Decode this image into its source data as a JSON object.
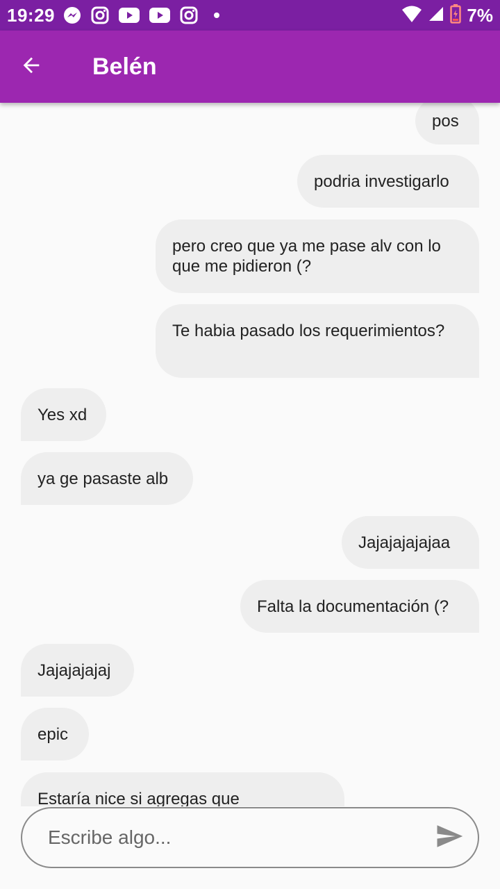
{
  "status_bar": {
    "time": "19:29",
    "battery": "7%",
    "notification_icons": [
      "messenger-icon",
      "instagram-icon",
      "youtube-icon",
      "youtube-icon",
      "instagram-icon",
      "dot-icon"
    ],
    "system_icons": [
      "wifi-icon",
      "signal-icon",
      "battery-low-icon"
    ],
    "color": "#7b1fa2"
  },
  "app_bar": {
    "title": "Belén",
    "color": "#9c27b0"
  },
  "messages": [
    {
      "from": "me",
      "text": "pos"
    },
    {
      "from": "me",
      "text": "podria investigarlo"
    },
    {
      "from": "me",
      "text": "pero creo que ya me pase alv con lo que me pidieron (?"
    },
    {
      "from": "me",
      "text": "Te habia pasado los requerimientos?"
    },
    {
      "from": "other",
      "text": "Yes xd"
    },
    {
      "from": "other",
      "text": "ya ge pasaste alb"
    },
    {
      "from": "me",
      "text": "Jajajajajajaa"
    },
    {
      "from": "me",
      "text": "Falta la documentación (?"
    },
    {
      "from": "other",
      "text": "Jajajajajaj"
    },
    {
      "from": "other",
      "text": "epic"
    },
    {
      "from": "other",
      "text": "Estaría nice si agregas que"
    }
  ],
  "composer": {
    "placeholder": "Escribe algo...",
    "send_icon": "send-icon"
  }
}
